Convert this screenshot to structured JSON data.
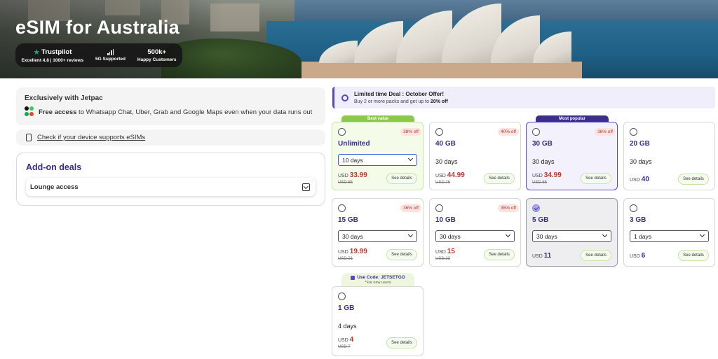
{
  "hero": {
    "title": "eSIM for Australia",
    "trustpilot_label": "Trustpilot",
    "trustpilot_sub": "Excellent 4.8 | 1000+ reviews",
    "network_sub": "5G Supported",
    "customers_top": "500k+",
    "customers_sub": "Happy Customers"
  },
  "exclusive": {
    "title": "Exclusively with Jetpac",
    "free_access_bold": "Free access",
    "free_access_rest": " to Whatsapp Chat, Uber, Grab and Google Maps even when your data runs out"
  },
  "device_check": {
    "label": "Check if your device supports eSIMs"
  },
  "addons": {
    "title": "Add-on deals",
    "lounge": "Lounge access"
  },
  "deal": {
    "title": "Limited time Deal : October Offer!",
    "sub_prefix": "Buy 2 or more packs and get up to ",
    "sub_bold": "20% off"
  },
  "ribbons": {
    "best_value": "Best value",
    "most_popular": "Most popular",
    "code": "Use Code: JETSETGO",
    "code_sub": "*For new users"
  },
  "see_details": "See details",
  "currency": "USD",
  "plans": [
    {
      "name": "Unlimited",
      "duration": "10 days",
      "price": "33.99",
      "was": "USD 55",
      "discount": "38% off"
    },
    {
      "name": "40 GB",
      "duration": "30 days",
      "price": "44.99",
      "was": "USD 75",
      "discount": "40% off"
    },
    {
      "name": "30 GB",
      "duration": "30 days",
      "price": "34.99",
      "was": "USD 55",
      "discount": "36% off"
    },
    {
      "name": "20 GB",
      "duration": "30 days",
      "price": "40"
    },
    {
      "name": "15 GB",
      "duration": "30 days",
      "price": "19.99",
      "was": "USD 31",
      "discount": "36% off"
    },
    {
      "name": "10 GB",
      "duration": "30 days",
      "price": "15",
      "was": "USD 23",
      "discount": "35% off"
    },
    {
      "name": "5 GB",
      "duration": "30 days",
      "price": "11",
      "selected": true
    },
    {
      "name": "3 GB",
      "duration": "1 days",
      "price": "6"
    },
    {
      "name": "1 GB",
      "duration": "4 days",
      "price": "4",
      "was": "USD 7"
    }
  ],
  "colors": {
    "brand": "#3b2d8f",
    "discount": "#c0392b",
    "best_value": "#8bc84a",
    "trustpilot": "#00b67a"
  }
}
